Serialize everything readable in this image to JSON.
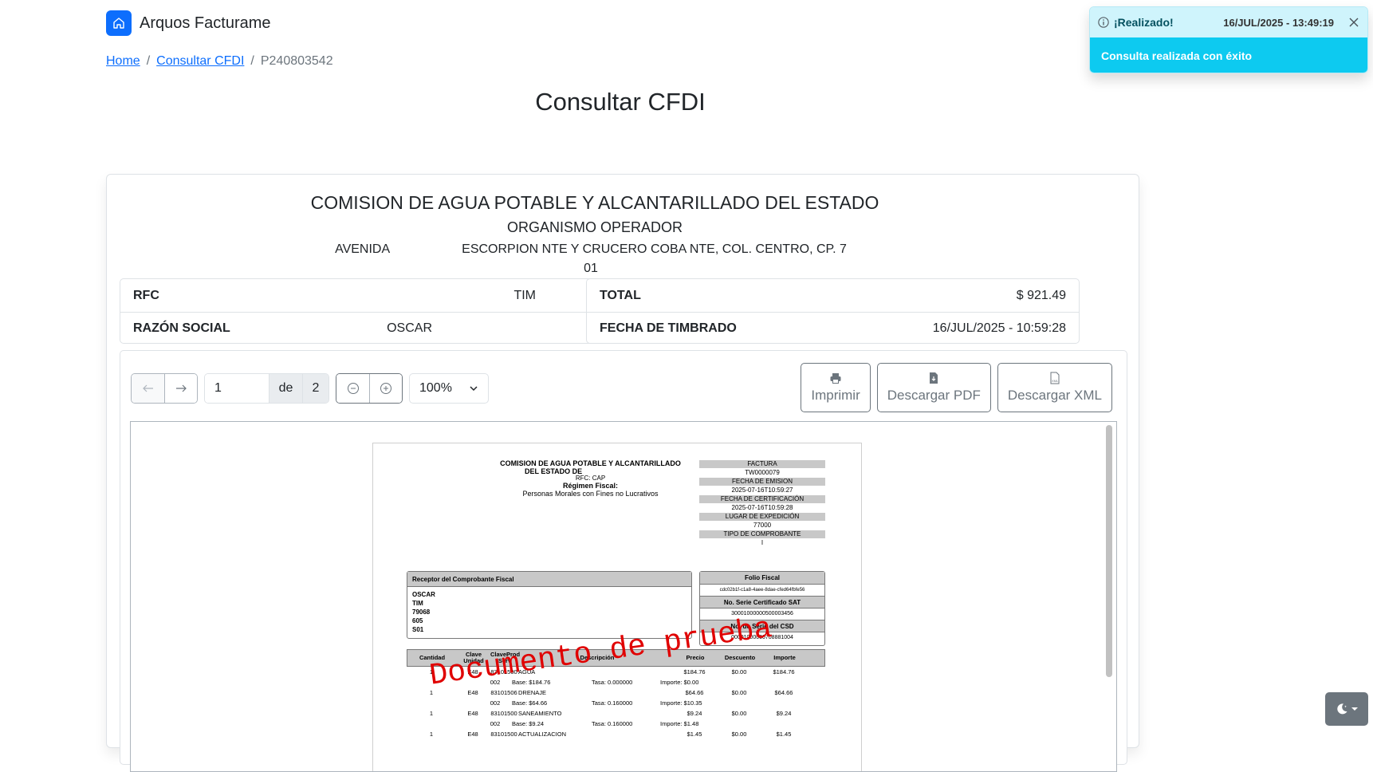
{
  "app": {
    "name": "Arquos Facturame"
  },
  "breadcrumb": {
    "home": "Home",
    "consult": "Consultar CFDI",
    "current": "P240803542",
    "sep": "/"
  },
  "page": {
    "title": "Consultar CFDI"
  },
  "issuer": {
    "name": "COMISION DE AGUA POTABLE Y ALCANTARILLADO DEL ESTADO",
    "org": "ORGANISMO OPERADOR",
    "address_a": "AVENIDA",
    "address_b": "ESCORPION NTE Y CRUCERO COBA NTE, COL. CENTRO, CP. 7",
    "zip_line": "01"
  },
  "summary": {
    "rfc_label": "RFC",
    "rfc_value": "TIM",
    "razon_label": "RAZÓN SOCIAL",
    "razon_value": "OSCAR",
    "total_label": "TOTAL",
    "total_value": "$ 921.49",
    "fecha_label": "FECHA DE TIMBRADO",
    "fecha_value": "16/JUL/2025 - 10:59:28"
  },
  "viewer": {
    "page_value": "1",
    "page_sep": "de",
    "page_total": "2",
    "zoom": "100%",
    "print_label": "Imprimir",
    "pdf_label": "Descargar PDF",
    "xml_label": "Descargar XML"
  },
  "pdf": {
    "issuer_l1": "COMISION DE AGUA POTABLE Y ALCANTARILLADO",
    "issuer_l2": "DEL ESTADO DE",
    "issuer_rfc": "RFC: CAP",
    "regimen_label": "Régimen Fiscal:",
    "regimen_value": "Personas Morales con Fines no Lucrativos",
    "facts": [
      {
        "label": "FACTURA",
        "value": "TW0000079"
      },
      {
        "label": "FECHA DE EMISION",
        "value": "2025-07-16T10:59:27"
      },
      {
        "label": "FECHA DE CERTIFICACIÓN",
        "value": "2025-07-16T10:59:28"
      },
      {
        "label": "LUGAR DE EXPEDICIÓN",
        "value": "77000"
      },
      {
        "label": "TIPO DE COMPROBANTE",
        "value": "I"
      }
    ],
    "receptor_title": "Receptor del Comprobante Fiscal",
    "receptor_lines": [
      "OSCAR",
      "TIM",
      "79068",
      "605",
      "S01"
    ],
    "folio_title": "Folio Fiscal",
    "folio_value": "cdc02b1f-c1a8-4aee-8dae-cfed64fbfe56",
    "serie_sat_title": "No. Serie Certificado SAT",
    "serie_sat_value": "30001000000500003456",
    "serie_csd_title": "No. de Serie del CSD",
    "serie_csd_value": "00001000000708881004",
    "items_headers": [
      "Cantidad",
      "Clave Unidad",
      "ClaveProd Serv",
      "Descripción",
      "Precio",
      "Descuento",
      "Importe"
    ],
    "items": [
      {
        "qty": "1",
        "unit": "E48",
        "prod": "83101500",
        "desc": "AGUA",
        "price": "$184.76",
        "disc": "$0.00",
        "amount": "$184.76",
        "sub_code": "002",
        "sub_base": "Base: $184.76",
        "sub_tasa": "Tasa:  0.000000",
        "sub_importe": "Importe: $0.00"
      },
      {
        "qty": "1",
        "unit": "E48",
        "prod": "83101506",
        "desc": "DRENAJE",
        "price": "$64.66",
        "disc": "$0.00",
        "amount": "$64.66",
        "sub_code": "002",
        "sub_base": "Base: $64.66",
        "sub_tasa": "Tasa:  0.160000",
        "sub_importe": "Importe: $10.35"
      },
      {
        "qty": "1",
        "unit": "E48",
        "prod": "83101500",
        "desc": "SANEAMIENTO",
        "price": "$9.24",
        "disc": "$0.00",
        "amount": "$9.24",
        "sub_code": "002",
        "sub_base": "Base: $9.24",
        "sub_tasa": "Tasa:  0.160000",
        "sub_importe": "Importe: $1.48"
      },
      {
        "qty": "1",
        "unit": "E48",
        "prod": "83101500",
        "desc": "ACTUALIZACION",
        "price": "$1.45",
        "disc": "$0.00",
        "amount": "$1.45"
      }
    ],
    "watermark": "Documento de prueba"
  },
  "toast": {
    "title": "¡Realizado!",
    "time": "16/JUL/2025 - 13:49:19",
    "message": "Consulta realizada con éxito"
  }
}
